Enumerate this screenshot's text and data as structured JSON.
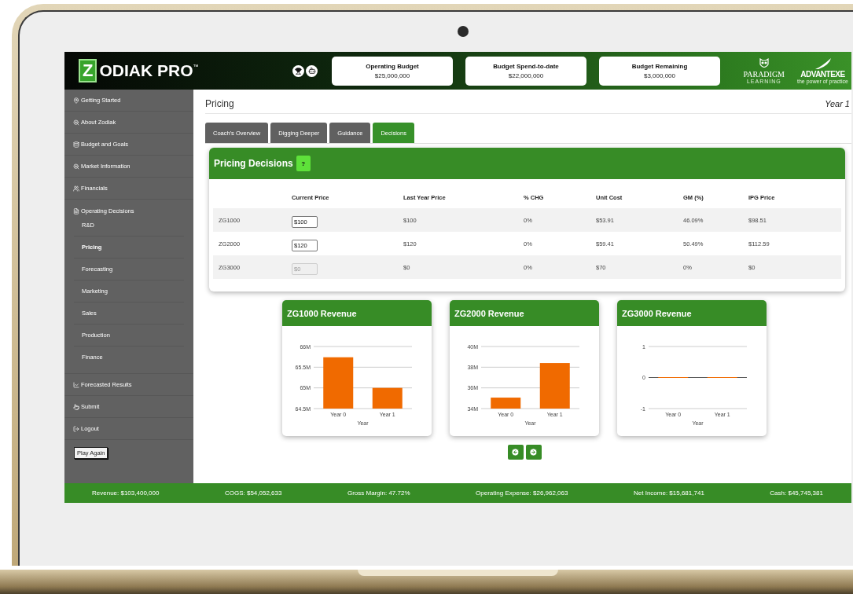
{
  "header": {
    "logo": {
      "initial": "Z",
      "text": "ODIAK PRO",
      "mark": "™"
    },
    "budget_cards": [
      {
        "label": "Operating Budget",
        "value": "$25,000,000"
      },
      {
        "label": "Budget Spend-to-date",
        "value": "$22,000,000"
      },
      {
        "label": "Budget Remaining",
        "value": "$3,000,000"
      }
    ],
    "partner_logos": [
      {
        "name": "PARADIGM",
        "subtitle": "LEARNING"
      },
      {
        "name": "ADVANTEXE",
        "subtitle": "the power of practice"
      }
    ]
  },
  "sidebar": {
    "items": [
      {
        "label": "Getting Started"
      },
      {
        "label": "About Zodiak"
      },
      {
        "label": "Budget and Goals"
      },
      {
        "label": "Market Information"
      },
      {
        "label": "Financials"
      },
      {
        "label": "Operating Decisions",
        "children": [
          {
            "label": "R&D",
            "selected": false
          },
          {
            "label": "Pricing",
            "selected": true
          },
          {
            "label": "Forecasting",
            "selected": false
          },
          {
            "label": "Marketing",
            "selected": false
          },
          {
            "label": "Sales",
            "selected": false
          },
          {
            "label": "Production",
            "selected": false
          },
          {
            "label": "Finance",
            "selected": false
          }
        ]
      },
      {
        "label": "Forecasted Results"
      },
      {
        "label": "Submit"
      },
      {
        "label": "Logout"
      }
    ],
    "play_again_button": "Play Again"
  },
  "page": {
    "title": "Pricing",
    "year": "Year 1"
  },
  "tabs": [
    {
      "label": "Coach's Overview",
      "selected": false
    },
    {
      "label": "Digging Deeper",
      "selected": false
    },
    {
      "label": "Guidance",
      "selected": false
    },
    {
      "label": "Decisions",
      "selected": true
    }
  ],
  "pricing_card": {
    "title": "Pricing Decisions",
    "help_button": "?",
    "columns": [
      "Current Price",
      "Last Year Price",
      "% CHG",
      "Unit Cost",
      "GM (%)",
      "IPG Price"
    ],
    "rows": [
      {
        "product": "ZG1000",
        "current_price": "$100",
        "disabled": false,
        "last_year_price": "$100",
        "chg": "0%",
        "unit_cost": "$53.91",
        "gm": "46.09%",
        "ipg_price": "$98.51"
      },
      {
        "product": "ZG2000",
        "current_price": "$120",
        "disabled": false,
        "last_year_price": "$120",
        "chg": "0%",
        "unit_cost": "$59.41",
        "gm": "50.49%",
        "ipg_price": "$112.59"
      },
      {
        "product": "ZG3000",
        "current_price": "$0",
        "disabled": true,
        "last_year_price": "$0",
        "chg": "0%",
        "unit_cost": "$70",
        "gm": "0%",
        "ipg_price": "$0"
      }
    ]
  },
  "charts": [
    {
      "title": "ZG1000 Revenue",
      "chart_data": {
        "type": "bar",
        "xlabel": "Year",
        "categories": [
          "Year 0",
          "Year 1"
        ],
        "series": [
          {
            "color": "#f06a00",
            "values": [
              65.74,
              65.0
            ]
          }
        ],
        "ylim": [
          64.5,
          66
        ],
        "yticks": [
          {
            "value": 64.5,
            "label": "64.5M"
          },
          {
            "value": 65,
            "label": "65M"
          },
          {
            "value": 65.5,
            "label": "65.5M"
          },
          {
            "value": 66,
            "label": "66M"
          }
        ]
      }
    },
    {
      "title": "ZG2000 Revenue",
      "chart_data": {
        "type": "bar",
        "xlabel": "Year",
        "categories": [
          "Year 0",
          "Year 1"
        ],
        "series": [
          {
            "color": "#f06a00",
            "values": [
              35.06,
              38.4
            ]
          }
        ],
        "ylim": [
          34,
          40
        ],
        "yticks": [
          {
            "value": 34,
            "label": "34M"
          },
          {
            "value": 36,
            "label": "36M"
          },
          {
            "value": 38,
            "label": "38M"
          },
          {
            "value": 40,
            "label": "40M"
          }
        ]
      }
    },
    {
      "title": "ZG3000 Revenue",
      "chart_data": {
        "type": "bar",
        "xlabel": "Year",
        "categories": [
          "Year 0",
          "Year 1"
        ],
        "series": [
          {
            "color": "#f06a00",
            "values": [
              0,
              0
            ]
          }
        ],
        "ylim": [
          -1,
          1
        ],
        "yticks": [
          {
            "value": -1,
            "label": "-1"
          },
          {
            "value": 0,
            "label": "0"
          },
          {
            "value": 1,
            "label": "1"
          }
        ]
      }
    }
  ],
  "status_bar": [
    "Revenue: $103,400,000",
    "COGS: $54,052,633",
    "Gross Margin: 47.72%",
    "Operating Expense: $26,962,063",
    "Net Income: $15,681,741",
    "Cash: $45,745,381"
  ]
}
